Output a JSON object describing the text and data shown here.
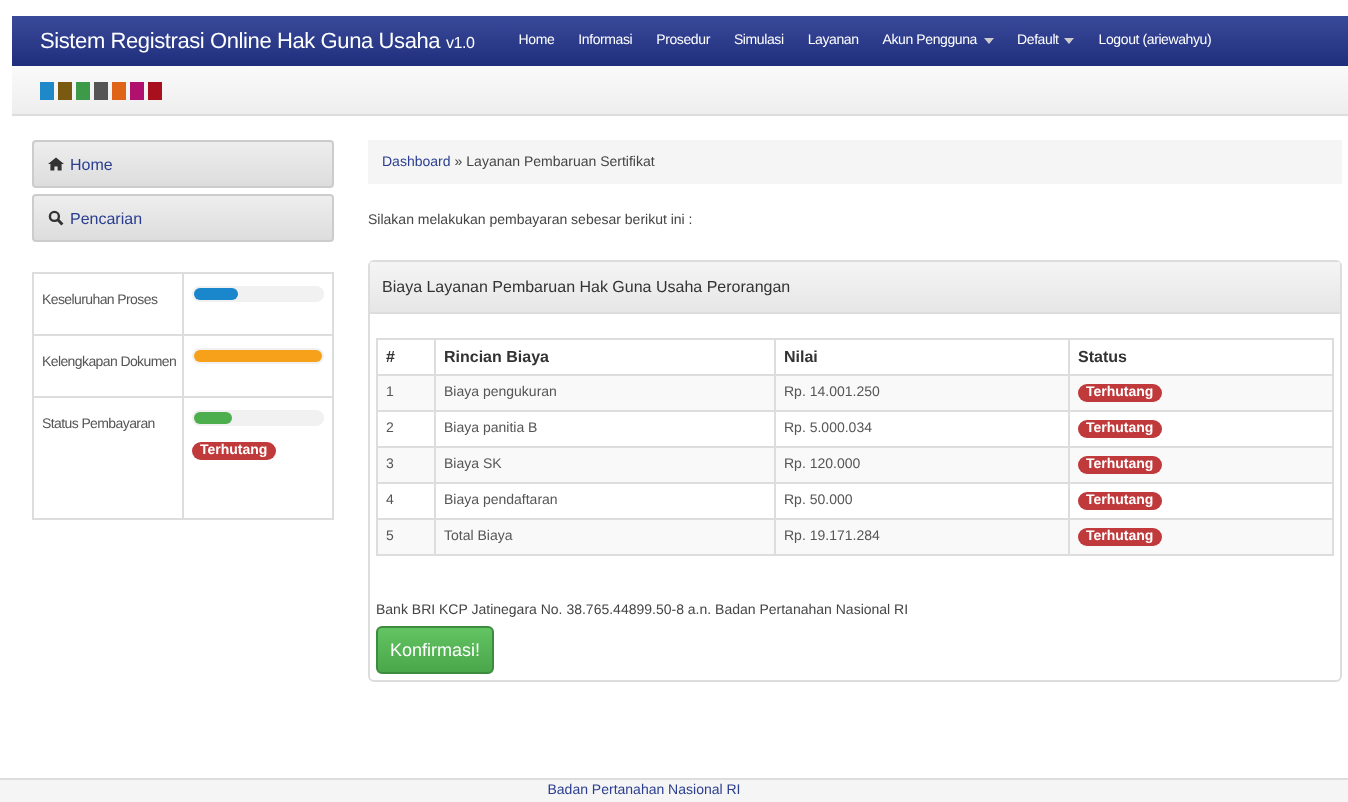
{
  "navbar": {
    "brand": "Sistem Registrasi Online Hak Guna Usaha",
    "version": "v1.0",
    "items": [
      {
        "label": "Home",
        "dropdown": false
      },
      {
        "label": "Informasi",
        "dropdown": false
      },
      {
        "label": "Prosedur",
        "dropdown": false
      },
      {
        "label": "Simulasi",
        "dropdown": false
      },
      {
        "label": "Layanan",
        "dropdown": false
      },
      {
        "label": "Akun Pengguna",
        "dropdown": true
      },
      {
        "label": "Default",
        "dropdown": true
      },
      {
        "label": "Logout (ariewahyu)",
        "dropdown": false
      }
    ]
  },
  "theme_swatches": [
    {
      "color": "#1e88c8"
    },
    {
      "color": "#7a5a10"
    },
    {
      "color": "#3c9a48"
    },
    {
      "color": "#555555"
    },
    {
      "color": "#e06418"
    },
    {
      "color": "#b0106e"
    },
    {
      "color": "#a8101e"
    }
  ],
  "sidebar": {
    "menu": [
      {
        "label": "Home"
      },
      {
        "label": "Pencarian"
      }
    ],
    "progress": [
      {
        "label": "Keseluruhan Proses",
        "level": 0.35,
        "color": "#1a86cc"
      },
      {
        "label": "Kelengkapan Dokumen",
        "level": 1,
        "color": "#f7a11a"
      },
      {
        "label": "Status Pembayaran",
        "level": 0.3,
        "color": "#4cae4c",
        "badge": "Terhutang"
      }
    ]
  },
  "breadcrumb": [
    "Dashboard",
    "Layanan Pembaruan Sertifikat"
  ],
  "breadcrumb_separator": "»",
  "intro": "Silakan melakukan pembayaran sebesar berikut ini :",
  "panel": {
    "title": "Biaya Layanan Pembaruan Hak Guna Usaha Perorangan",
    "table": {
      "columns": [
        "#",
        "Rincian Biaya",
        "Nilai",
        "Status"
      ],
      "rows": [
        [
          "1",
          "Biaya pengukuran",
          "Rp. 14.001.250",
          "Terhutang"
        ],
        [
          "2",
          "Biaya panitia B",
          "Rp. 5.000.034",
          "Terhutang"
        ],
        [
          "3",
          "Biaya SK",
          "Rp. 120.000",
          "Terhutang"
        ],
        [
          "4",
          "Biaya pendaftaran",
          "Rp. 50.000",
          "Terhutang"
        ],
        [
          "5",
          "Total Biaya",
          "Rp. 19.171.284",
          "Terhutang"
        ]
      ]
    },
    "bank_note": "Bank BRI KCP Jatinegara No. 38.765.44899.50-8 a.n. Badan Pertanahan Nasional RI",
    "button": "Konfirmasi!"
  },
  "footer": "Badan Pertanahan Nasional RI"
}
